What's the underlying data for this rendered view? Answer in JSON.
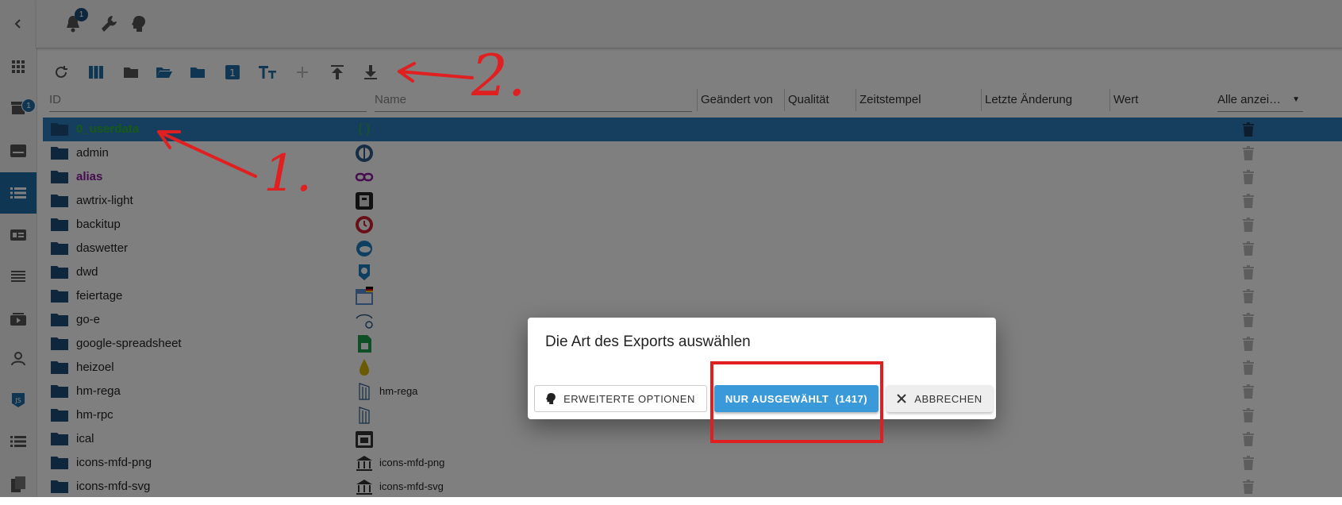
{
  "sidebar": {
    "badge": "1"
  },
  "topbar": {
    "notification_count": "1"
  },
  "table": {
    "columns": {
      "id_placeholder": "ID",
      "name_placeholder": "Name",
      "changed_by": "Geändert von",
      "quality": "Qualität",
      "timestamp": "Zeitstempel",
      "last_change": "Letzte Änderung",
      "value": "Wert",
      "show_all": "Alle anzei…"
    },
    "rows": [
      {
        "name": "0_userdata",
        "desc": ""
      },
      {
        "name": "admin",
        "desc": ""
      },
      {
        "name": "alias",
        "desc": ""
      },
      {
        "name": "awtrix-light",
        "desc": ""
      },
      {
        "name": "backitup",
        "desc": ""
      },
      {
        "name": "daswetter",
        "desc": ""
      },
      {
        "name": "dwd",
        "desc": ""
      },
      {
        "name": "feiertage",
        "desc": ""
      },
      {
        "name": "go-e",
        "desc": ""
      },
      {
        "name": "google-spreadsheet",
        "desc": ""
      },
      {
        "name": "heizoel",
        "desc": ""
      },
      {
        "name": "hm-rega",
        "desc": "hm-rega"
      },
      {
        "name": "hm-rpc",
        "desc": ""
      },
      {
        "name": "ical",
        "desc": ""
      },
      {
        "name": "icons-mfd-png",
        "desc": "icons-mfd-png"
      },
      {
        "name": "icons-mfd-svg",
        "desc": "icons-mfd-svg"
      }
    ]
  },
  "dialog": {
    "title": "Die Art des Exports auswählen",
    "advanced_label": "ERWEITERTE OPTIONEN",
    "selected_label": "NUR AUSGEWÄHLT  (1417)",
    "cancel_label": "ABBRECHEN"
  },
  "annotations": {
    "one": "1.",
    "two": "2."
  },
  "colors": {
    "accent": "#1f6fa8",
    "primary_button": "#3a9ad9",
    "annotation": "#e02020",
    "folder": "#1f4f7a"
  }
}
